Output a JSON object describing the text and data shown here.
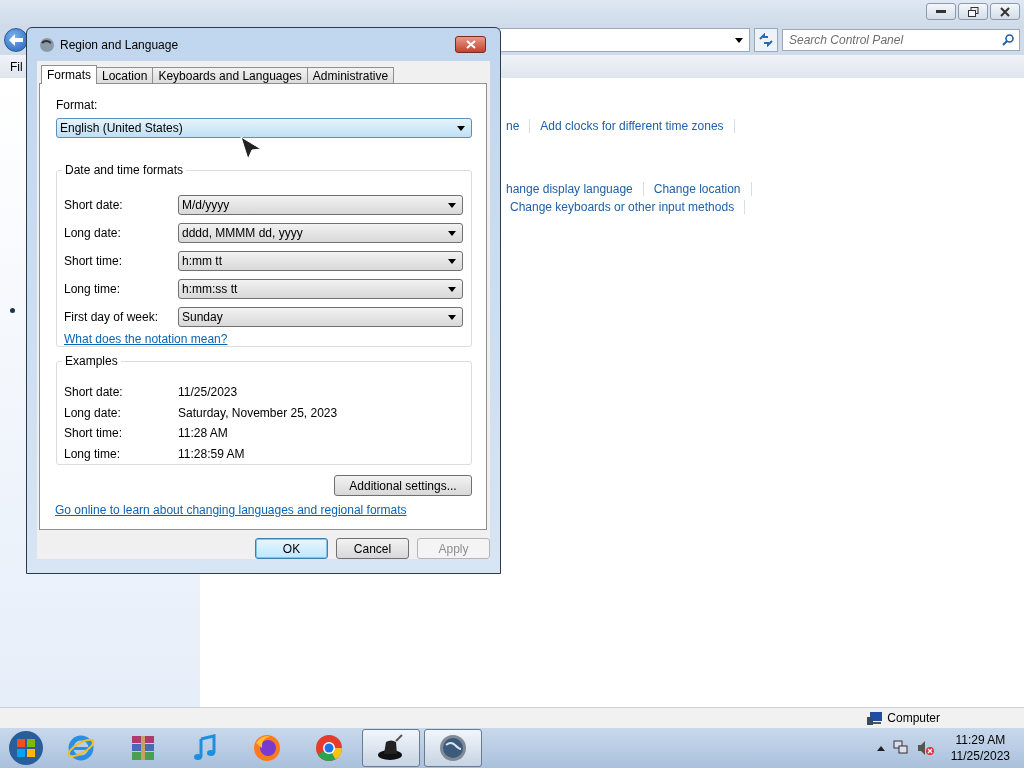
{
  "explorer": {
    "search": {
      "placeholder": "Search Control Panel"
    },
    "menu": [
      "Fil"
    ],
    "link_rows": [
      [
        "ne",
        "Add clocks for different time zones"
      ],
      [
        "hange display language",
        "Change location"
      ],
      [
        "Change keyboards or other input methods"
      ]
    ],
    "status_bar": {
      "text": "Computer"
    }
  },
  "dialog": {
    "title": "Region and Language",
    "tabs": [
      {
        "label": "Formats",
        "selected": true
      },
      {
        "label": "Location",
        "selected": false
      },
      {
        "label": "Keyboards and Languages",
        "selected": false
      },
      {
        "label": "Administrative",
        "selected": false
      }
    ],
    "format_label": "Format:",
    "format_value": "English (United States)",
    "formats_group": {
      "title": "Date and time formats",
      "rows": [
        {
          "label": "Short date:",
          "value": "M/d/yyyy"
        },
        {
          "label": "Long date:",
          "value": "dddd, MMMM dd, yyyy"
        },
        {
          "label": "Short time:",
          "value": "h:mm tt"
        },
        {
          "label": "Long time:",
          "value": "h:mm:ss tt"
        },
        {
          "label": "First day of week:",
          "value": "Sunday"
        }
      ],
      "link": "What does the notation mean?"
    },
    "examples": {
      "title": "Examples",
      "rows": [
        {
          "label": "Short date:",
          "value": "11/25/2023"
        },
        {
          "label": "Long date:",
          "value": "Saturday, November 25, 2023"
        },
        {
          "label": "Short time:",
          "value": "11:28 AM"
        },
        {
          "label": "Long time:",
          "value": "11:28:59 AM"
        }
      ]
    },
    "additional_button": "Additional settings...",
    "online_link": "Go online to learn about changing languages and regional formats",
    "buttons": [
      {
        "label": "OK",
        "default": true,
        "disabled": false
      },
      {
        "label": "Cancel",
        "default": false,
        "disabled": false
      },
      {
        "label": "Apply",
        "default": false,
        "disabled": true
      }
    ]
  },
  "taskbar": {
    "apps": [
      {
        "kind": "ie",
        "active": false
      },
      {
        "kind": "archive",
        "active": false
      },
      {
        "kind": "music",
        "active": false
      },
      {
        "kind": "firefox",
        "active": false
      },
      {
        "kind": "chrome",
        "active": false
      },
      {
        "kind": "hat",
        "active": true
      },
      {
        "kind": "globe",
        "active": true
      }
    ],
    "clock": {
      "time": "11:29 AM",
      "date": "11/25/2023"
    }
  }
}
